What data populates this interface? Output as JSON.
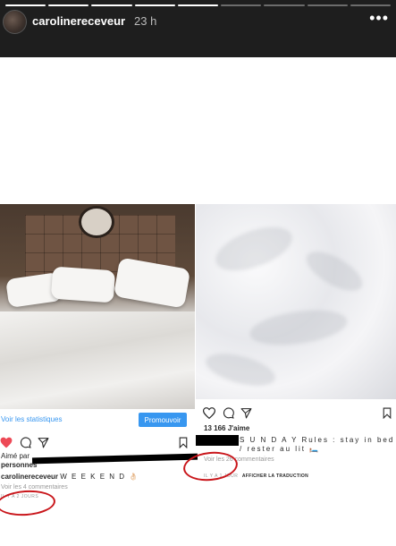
{
  "story": {
    "username": "carolinereceveur",
    "time": "23 h",
    "more_label": "•••",
    "progress": [
      1,
      1,
      1,
      1,
      1,
      0,
      0,
      0,
      0
    ]
  },
  "left_post": {
    "stats_link": "Voir les statistiques",
    "promote_label": "Promouvoir",
    "liked_prefix": "Aimé par",
    "liked_suffix": "personnes",
    "caption_user": "carolinereceveur",
    "caption_text": "W E E K E N D 👌🏻",
    "comments": "Voir les 4 commentaires",
    "time_ago": "IL Y A 2 JOURS"
  },
  "right_post": {
    "likes": "13 166 J'aime",
    "caption_text": "S U N D A Y Rules : stay in bed / rester au lit 🛏️",
    "comments": "Voir les 26 commentaires",
    "time_ago": "IL Y A 1 JOUR",
    "translate": "AFFICHER LA TRADUCTION"
  },
  "colors": {
    "accent": "#3897f0",
    "heart": "#ed4956",
    "annotation": "#c9161b"
  }
}
